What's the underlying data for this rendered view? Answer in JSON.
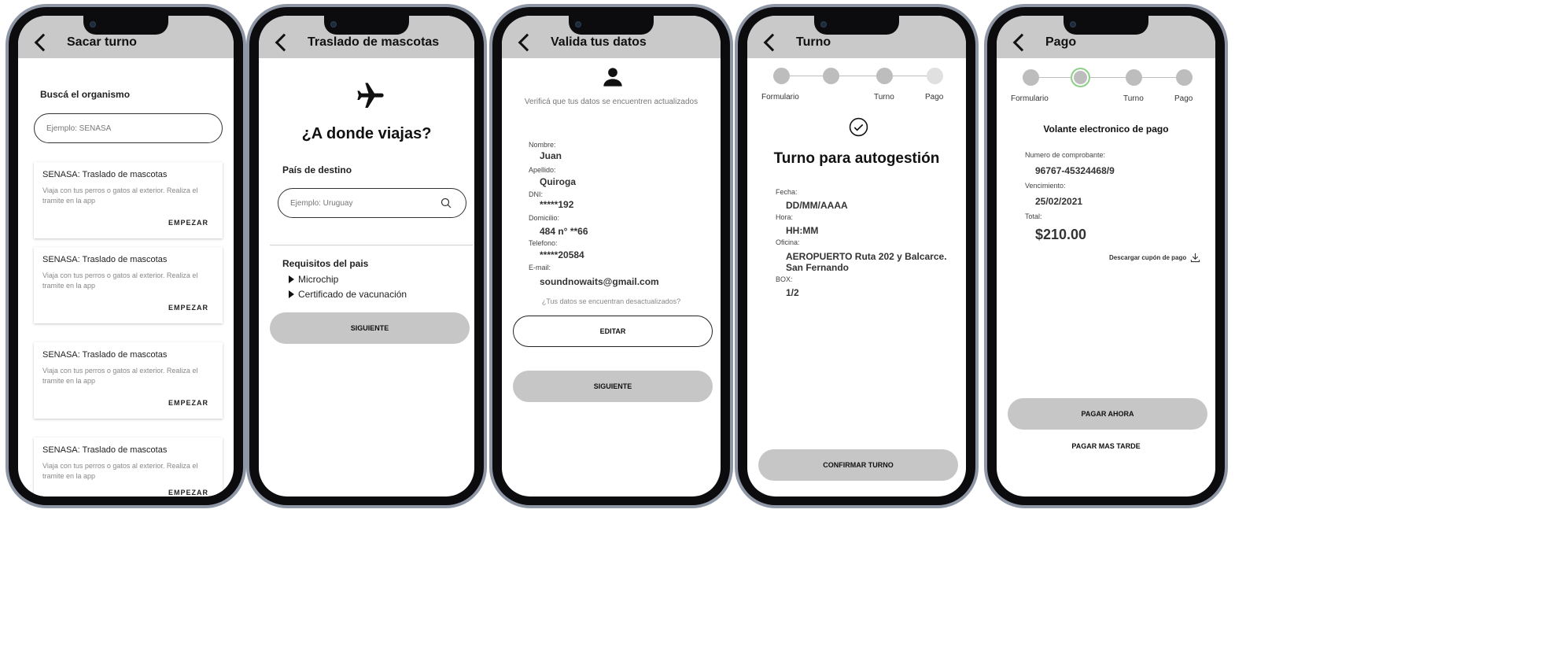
{
  "screens": [
    {
      "title": "Sacar turno",
      "search_heading": "Buscá el organismo",
      "search_placeholder": "Ejemplo: SENASA",
      "cards": [
        {
          "title": "SENASA: Traslado de mascotas",
          "desc": "Viaja con tus perros o gatos al exterior. Realiza el tramite en la app",
          "cta": "EMPEZAR"
        },
        {
          "title": "SENASA: Traslado de mascotas",
          "desc": "Viaja con tus perros o gatos al exterior. Realiza el tramite en la app",
          "cta": "EMPEZAR"
        },
        {
          "title": "SENASA: Traslado de mascotas",
          "desc": "Viaja con tus perros o gatos al exterior. Realiza el tramite en la app",
          "cta": "EMPEZAR"
        },
        {
          "title": "SENASA: Traslado de mascotas",
          "desc": "Viaja con tus perros o gatos al exterior. Realiza el tramite en la app",
          "cta": "EMPEZAR"
        }
      ]
    },
    {
      "title": "Traslado de mascotas",
      "icon": "airplane-icon",
      "heading": "¿A donde viajas?",
      "field_label": "País de destino",
      "search_placeholder": "Ejemplo: Uruguay",
      "requirements_heading": "Requisitos del pais",
      "requirements": [
        "Microchip",
        "Certificado de vacunación"
      ],
      "next_button": "SIGUIENTE"
    },
    {
      "title": "Valida tus datos",
      "icon": "person-icon",
      "subtitle": "Verificá que tus datos se encuentren actualizados",
      "fields": [
        {
          "label": "Nombre:",
          "value": "Juan"
        },
        {
          "label": "Apellido:",
          "value": "Quiroga"
        },
        {
          "label": "DNI:",
          "value": "*****192"
        },
        {
          "label": "Domicilio:",
          "value": "484 n° **66"
        },
        {
          "label": "Telefono:",
          "value": "*****20584"
        },
        {
          "label": "E-mail:",
          "value": "soundnowaits@gmail.com"
        }
      ],
      "outdated_question": "¿Tus datos se encuentran desactualizados?",
      "edit_button": "EDITAR",
      "next_button": "SIGUIENTE"
    },
    {
      "title": "Turno",
      "steps": [
        "Formulario",
        "",
        "Turno",
        "Pago"
      ],
      "heading": "Turno para autogestión",
      "fields": [
        {
          "label": "Fecha:",
          "value": "DD/MM/AAAA"
        },
        {
          "label": "Hora:",
          "value": "HH:MM"
        },
        {
          "label": "Oficina:",
          "value": "AEROPUERTO Ruta 202 y Balcarce. San Fernando"
        },
        {
          "label": "BOX:",
          "value": "1/2"
        }
      ],
      "confirm_button": "CONFIRMAR TURNO"
    },
    {
      "title": "Pago",
      "steps": [
        "Formulario",
        "",
        "Turno",
        "Pago"
      ],
      "heading": "Volante electronico de pago",
      "fields": [
        {
          "label": "Numero de comprobante:",
          "value": "96767-45324468/9"
        },
        {
          "label": "Vencimiento:",
          "value": "25/02/2021"
        },
        {
          "label": "Total:",
          "value": "$210.00"
        }
      ],
      "download_link": "Descargar cupón de pago",
      "pay_now_button": "PAGAR AHORA",
      "pay_later_link": "PAGAR MAS TARDE"
    }
  ],
  "colors": {
    "appbar": "#c9c9c9",
    "button_grey": "#c6c6c6",
    "frame": "#8f97a6",
    "active_step_ring": "#8fd18a"
  }
}
